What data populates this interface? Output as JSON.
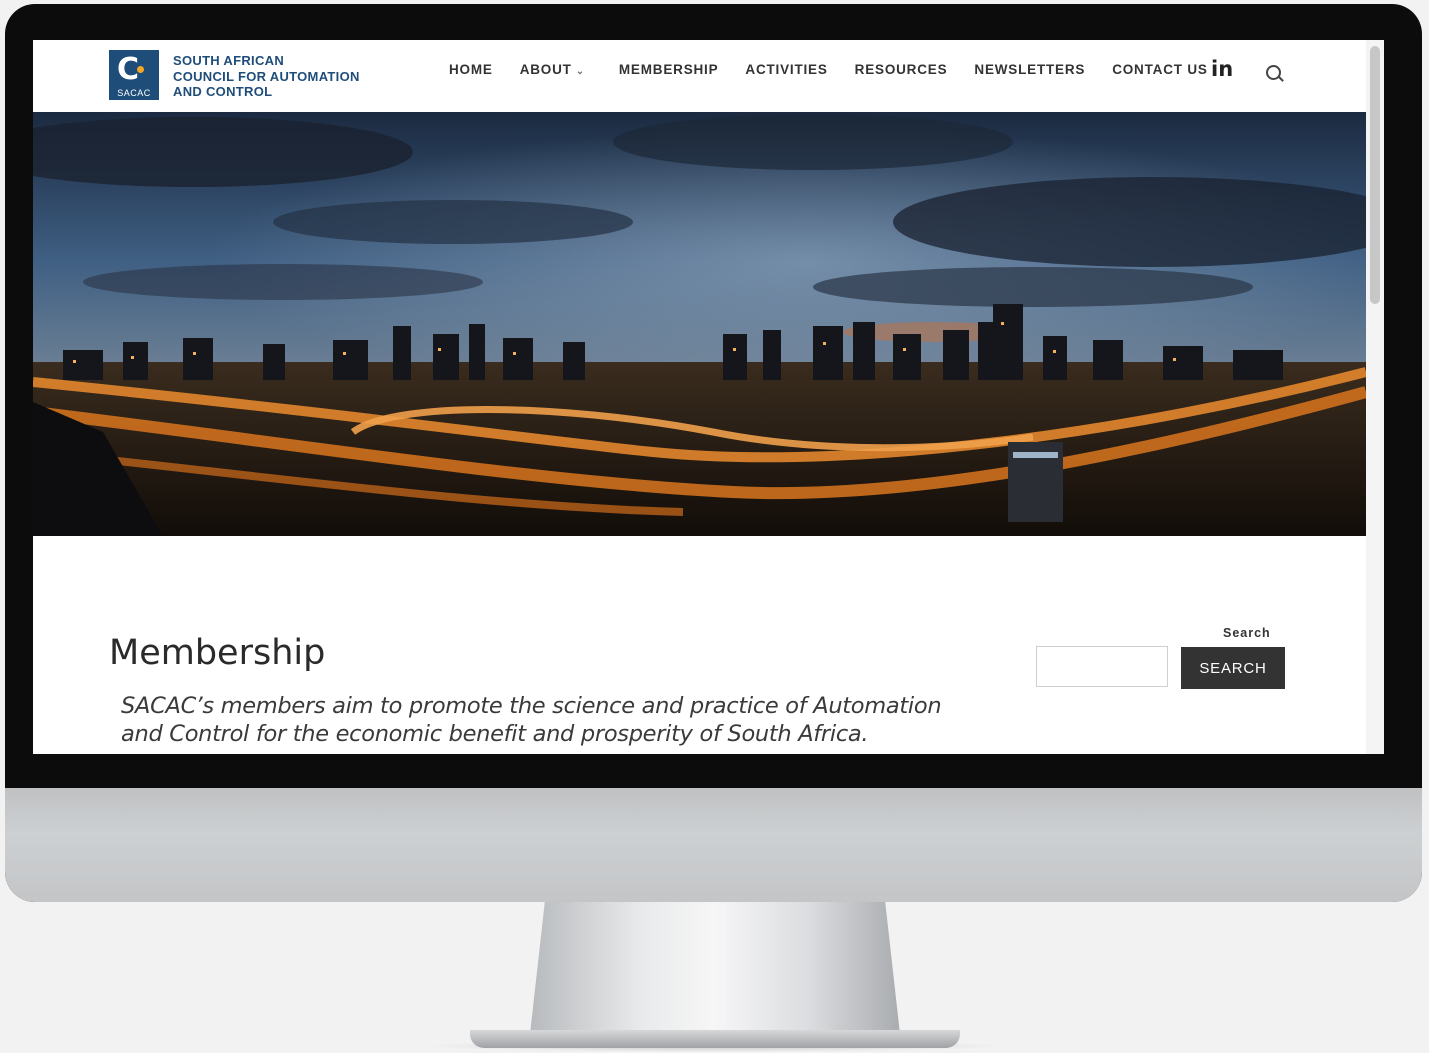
{
  "logo": {
    "mark": "C",
    "abbr": "SACAC",
    "line1": "SOUTH AFRICAN",
    "line2": "COUNCIL FOR AUTOMATION",
    "line3": "AND CONTROL"
  },
  "nav": {
    "items": [
      {
        "label": "HOME"
      },
      {
        "label": "ABOUT"
      },
      {
        "label": "MEMBERSHIP"
      },
      {
        "label": "ACTIVITIES"
      },
      {
        "label": "RESOURCES"
      },
      {
        "label": "NEWSLETTERS"
      },
      {
        "label": "CONTACT US"
      }
    ],
    "linkedin": "in",
    "icons": [
      "linkedin-icon",
      "search-icon",
      "chevron-down-icon"
    ]
  },
  "hero": {
    "scene": "city-skyline-night"
  },
  "main": {
    "title": "Membership",
    "lead": "SACAC’s members aim to promote the science and practice of Automation and Control for the economic benefit and prosperity of South Africa."
  },
  "sidebar": {
    "search_label": "Search",
    "search_value": "",
    "search_button": "SEARCH"
  },
  "colors": {
    "brand": "#1f4d7a",
    "accent": "#f6a623",
    "button": "#333333"
  }
}
